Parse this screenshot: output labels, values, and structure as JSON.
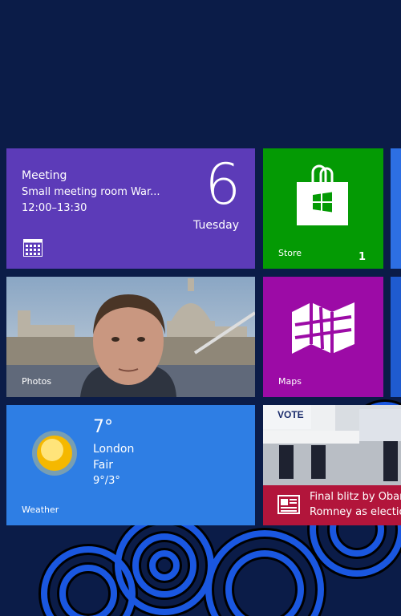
{
  "tiles": {
    "calendar": {
      "event_title": "Meeting",
      "event_location": "Small meeting room War...",
      "event_time": "12:00–13:30",
      "day_number": "6",
      "weekday": "Tuesday",
      "icon": "calendar-icon",
      "color": "#5c3bb8"
    },
    "store": {
      "name": "Store",
      "badge": "1",
      "icon": "shopping-bag-icon",
      "color": "#049a04"
    },
    "photos": {
      "name": "Photos"
    },
    "maps": {
      "name": "Maps",
      "icon": "map-icon",
      "color": "#9c0ba6"
    },
    "weather": {
      "name": "Weather",
      "temperature": "7°",
      "city": "London",
      "condition": "Fair",
      "range": "9°/3°",
      "icon": "sun-icon",
      "color": "#2e7ee4"
    },
    "news": {
      "headline_line1": "Final blitz by Obam",
      "headline_line2": "Romney as election",
      "image_sign": "VOTE",
      "icon": "newspaper-icon",
      "color": "#b2153b"
    }
  },
  "background_color": "#0b1c48"
}
